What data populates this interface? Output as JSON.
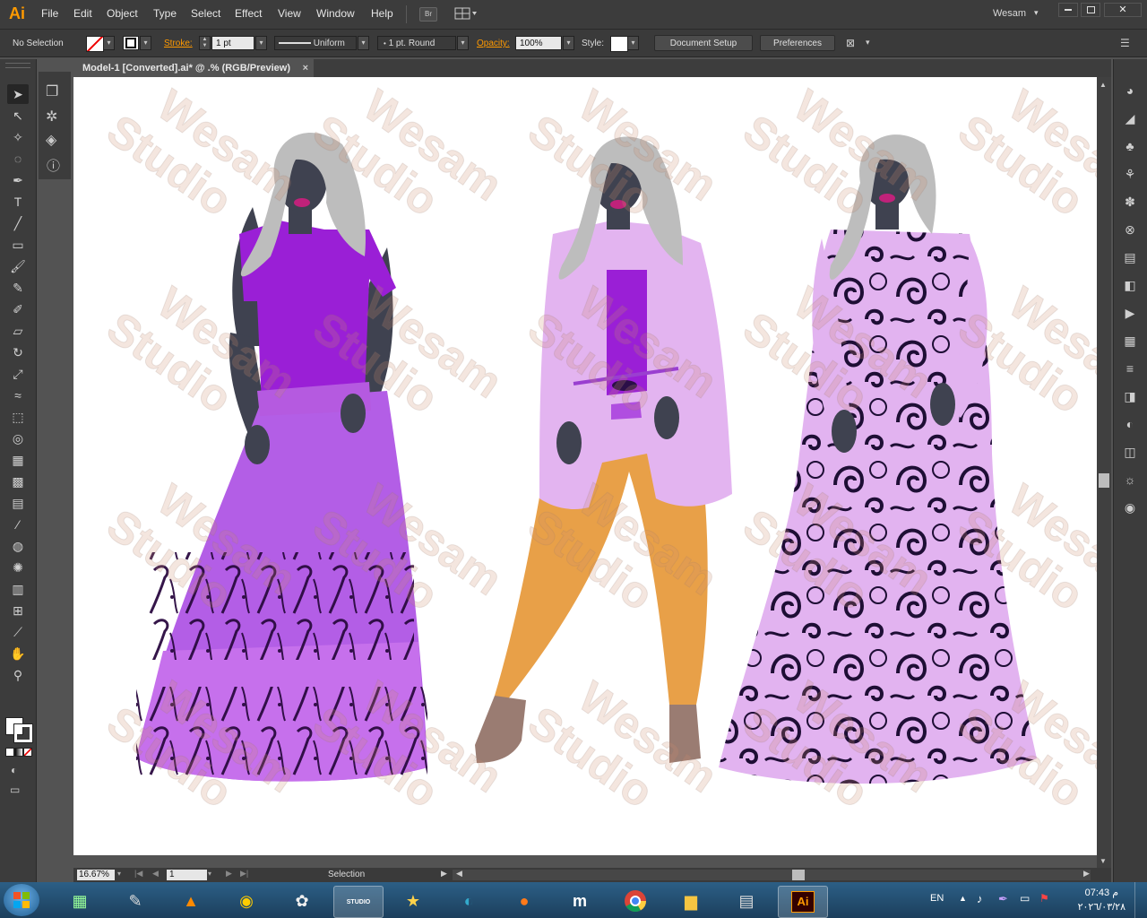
{
  "app": {
    "logo": "Ai"
  },
  "menu": [
    "File",
    "Edit",
    "Object",
    "Type",
    "Select",
    "Effect",
    "View",
    "Window",
    "Help"
  ],
  "bridge_label": "Br",
  "workspace": "Wesam",
  "control": {
    "selection": "No Selection",
    "stroke_label": "Stroke:",
    "stroke_weight": "1 pt",
    "profile": "Uniform",
    "brush": "1 pt. Round",
    "opacity_label": "Opacity:",
    "opacity": "100%",
    "style_label": "Style:",
    "document_setup": "Document Setup",
    "preferences": "Preferences"
  },
  "document": {
    "tab_title": "Model-1 [Converted].ai* @ .% (RGB/Preview)",
    "close": "×"
  },
  "status": {
    "zoom": "16.67%",
    "artboard": "1",
    "tool": "Selection"
  },
  "watermark": [
    "Wesam",
    "Studio"
  ],
  "taskbar": {
    "lang": "EN",
    "time": "07:43 م",
    "date": "٢٠٢٦/٠٣/٢٨",
    "studio_label": "STUDIO",
    "ai_label": "Ai"
  },
  "colors": {
    "dress1": "#b35ee6",
    "top1": "#9a1fd6",
    "jacket": "#e3b4f0",
    "pants": "#e8a048",
    "gown": "#e2b3f0",
    "pattern": "#1e0e35",
    "skin": "#3f4250",
    "hair": "#bdbdbd",
    "accent": "#ff9a00"
  },
  "icons": {
    "left_tools": [
      "selection-icon",
      "direct-selection-icon",
      "magic-wand-icon",
      "lasso-icon",
      "pen-icon",
      "type-icon",
      "line-icon",
      "rectangle-icon",
      "paintbrush-icon",
      "pencil-icon",
      "blob-brush-icon",
      "eraser-icon",
      "rotate-icon",
      "scale-icon",
      "warp-icon",
      "free-transform-icon",
      "shape-builder-icon",
      "perspective-icon",
      "mesh-icon",
      "gradient-icon",
      "eyedropper-icon",
      "blend-icon",
      "symbol-sprayer-icon",
      "graph-icon",
      "artboard-icon",
      "slice-icon",
      "hand-icon",
      "zoom-icon"
    ],
    "right_tools": [
      "color-icon",
      "color-guide-icon",
      "swatches-icon",
      "brushes-icon",
      "symbols-icon",
      "links-icon",
      "align-icon",
      "transform-icon",
      "actions-icon",
      "layers-icon",
      "stroke-icon",
      "gradient-panel-icon",
      "transparency-icon",
      "appearance-icon",
      "graphic-styles-icon",
      "navigator-icon"
    ]
  }
}
